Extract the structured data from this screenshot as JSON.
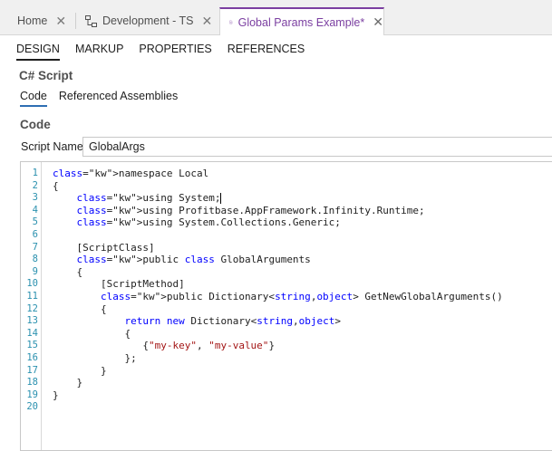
{
  "tabs": [
    {
      "label": "Home",
      "icon": "none",
      "active": false
    },
    {
      "label": "Development - TS",
      "icon": "hierarchy-icon",
      "active": false
    },
    {
      "label": "Global Params Example*",
      "icon": "document-icon",
      "active": true
    }
  ],
  "close_glyph": "✕",
  "subnav": [
    "DESIGN",
    "MARKUP",
    "PROPERTIES",
    "REFERENCES"
  ],
  "section_title": "C# Script",
  "inner_tabs": [
    "Code",
    "Referenced Assemblies"
  ],
  "code_title": "Code",
  "script_name": {
    "label": "Script Name",
    "value": "GlobalArgs"
  },
  "code_lines": [
    "namespace Local",
    "{",
    "    using System;",
    "    using Profitbase.AppFramework.Infinity.Runtime;",
    "    using System.Collections.Generic;",
    "",
    "    [ScriptClass]",
    "    public class GlobalArguments",
    "    {",
    "        [ScriptMethod]",
    "        public Dictionary<string,object> GetNewGlobalArguments()",
    "        {",
    "            return new Dictionary<string,object>",
    "            {",
    "               {\"my-key\", \"my-value\"}",
    "            };",
    "        }",
    "    }",
    "}",
    ""
  ],
  "colors": {
    "accent": "#7b3fa1",
    "keyword": "#0000ff",
    "string": "#a31515",
    "line_number": "#2b91af"
  }
}
